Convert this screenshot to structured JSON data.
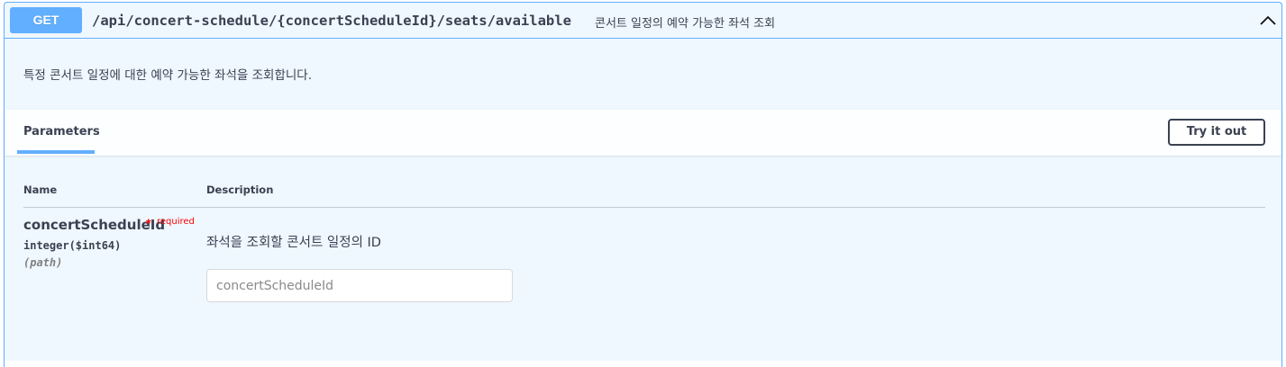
{
  "operation": {
    "method": "GET",
    "path": "/api/concert-schedule/{concertScheduleId}/seats/available",
    "summary": "콘서트 일정의 예약 가능한 좌석 조회",
    "description": "특정 콘서트 일정에 대한 예약 가능한 좌석을 조회합니다.",
    "collapse_icon": "chevron-up-icon"
  },
  "parameters_section": {
    "tab_label": "Parameters",
    "try_button_label": "Try it out",
    "columns": [
      "Name",
      "Description"
    ]
  },
  "parameter": {
    "name": "concertScheduleId",
    "required_star": "*",
    "required_label": "required",
    "type": "integer($int64)",
    "location": "(path)",
    "description": "좌석을 조회할 콘서트 일정의 ID",
    "input_placeholder": "concertScheduleId",
    "input_value": ""
  },
  "colors": {
    "get_accent": "#61affe",
    "text": "#3b4151",
    "required": "#ff0000"
  }
}
